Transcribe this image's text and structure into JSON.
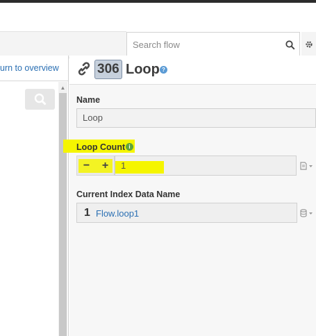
{
  "toolbar": {
    "search_placeholder": "Search flow",
    "search_icon": "search-icon",
    "settings_icon": "gear-icon"
  },
  "sidebar": {
    "return_link": "urn to overview",
    "search_icon": "search-icon"
  },
  "element": {
    "icon": "link-icon",
    "id": "306",
    "title": "Loop",
    "help_icon": "help-icon"
  },
  "fields": {
    "name": {
      "label": "Name",
      "value": "Loop"
    },
    "loop_count": {
      "label": "Loop Count",
      "info_icon": "info-icon",
      "decrement_label": "−",
      "increment_label": "+",
      "value": "1",
      "highlight_color": "#f5f500"
    },
    "index_name": {
      "label": "Current Index Data Name",
      "prefix": "1",
      "value": "Flow.loop1",
      "source_icon": "database-icon"
    }
  },
  "colors": {
    "accent": "#2a6fb3",
    "id_badge": "#c6d0dc",
    "highlight": "#f5f500"
  }
}
